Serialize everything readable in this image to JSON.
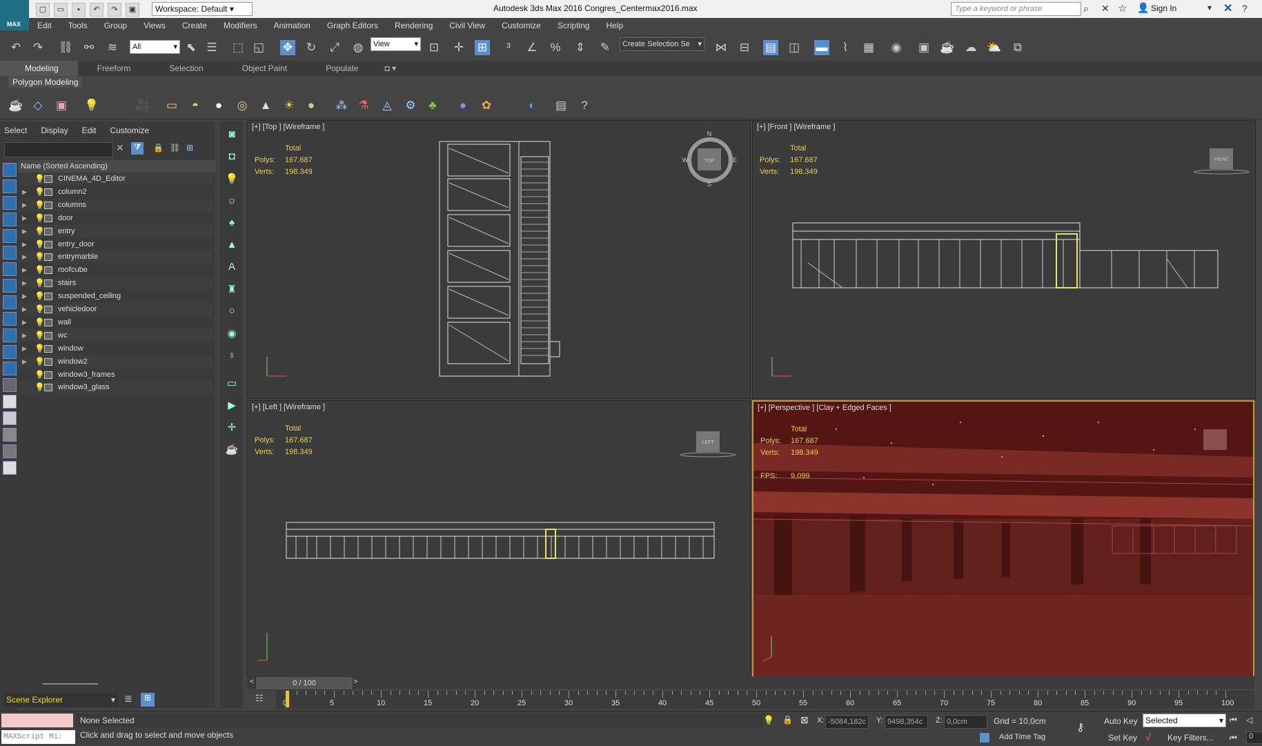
{
  "titlebar": {
    "workspace": "Workspace: Default",
    "app_title": "Autodesk 3ds Max 2016    Congres_Centermax2016.max",
    "search_placeholder": "Type a keyword or phrase",
    "sign_in": "Sign In",
    "logo_text": "MAX"
  },
  "menubar": [
    "Edit",
    "Tools",
    "Group",
    "Views",
    "Create",
    "Modifiers",
    "Animation",
    "Graph Editors",
    "Rendering",
    "Civil View",
    "Customize",
    "Scripting",
    "Help"
  ],
  "main_toolbar": {
    "selection_filter": "All",
    "ref_coord": "View",
    "named_selection": "Create Selection Se"
  },
  "ribbon": {
    "tabs": [
      "Modeling",
      "Freeform",
      "Selection",
      "Object Paint",
      "Populate"
    ],
    "active_tab": "Modeling",
    "panel_label": "Polygon Modeling"
  },
  "scene_explorer": {
    "menu": [
      "Select",
      "Display",
      "Edit",
      "Customize"
    ],
    "column_header": "Name (Sorted Ascending)",
    "items": [
      {
        "name": "CINEMA_4D_Editor",
        "expand": false
      },
      {
        "name": "column2",
        "expand": true
      },
      {
        "name": "columns",
        "expand": true
      },
      {
        "name": "door",
        "expand": true
      },
      {
        "name": "entry",
        "expand": true
      },
      {
        "name": "entry_door",
        "expand": true
      },
      {
        "name": "entrymarble",
        "expand": true
      },
      {
        "name": "roofcube",
        "expand": true
      },
      {
        "name": "stairs",
        "expand": true
      },
      {
        "name": "suspended_ceiling",
        "expand": true
      },
      {
        "name": "vehicledoor",
        "expand": true
      },
      {
        "name": "wall",
        "expand": true
      },
      {
        "name": "wc",
        "expand": true
      },
      {
        "name": "window",
        "expand": true
      },
      {
        "name": "window2",
        "expand": true
      },
      {
        "name": "window3_frames",
        "expand": false
      },
      {
        "name": "window3_glass",
        "expand": false
      }
    ],
    "footer_label": "Scene Explorer"
  },
  "viewports": {
    "top": {
      "label": "[+] [Top ] [Wireframe ]",
      "cube": "TOP"
    },
    "front": {
      "label": "[+] [Front ] [Wireframe ]",
      "cube": "FRONT"
    },
    "left": {
      "label": "[+] [Left ] [Wireframe ]",
      "cube": "LEFT"
    },
    "persp": {
      "label": "[+] [Perspective ] [Clay + Edged Faces ]",
      "fps_label": "FPS:",
      "fps": "9,099"
    },
    "stats": {
      "total": "Total",
      "polys_label": "Polys:",
      "polys": "167.687",
      "verts_label": "Verts:",
      "verts": "198.349"
    },
    "compass": {
      "n": "N",
      "s": "S",
      "e": "E",
      "w": "W"
    }
  },
  "timeline": {
    "slider": "0 / 100",
    "ticks": [
      "0",
      "5",
      "10",
      "15",
      "20",
      "25",
      "30",
      "35",
      "40",
      "45",
      "50",
      "55",
      "60",
      "65",
      "70",
      "75",
      "80",
      "85",
      "90",
      "95",
      "100"
    ]
  },
  "status": {
    "selection": "None Selected",
    "prompt": "Click and drag to select and move objects",
    "maxscript": "MAXScript Mi:",
    "x_label": "X:",
    "x": "-5084,182c",
    "y_label": "Y:",
    "y": "9498,354c",
    "z_label": "Z:",
    "z": "0,0cm",
    "grid": "Grid = 10,0cm",
    "add_time_tag": "Add Time Tag",
    "auto_key": "Auto Key",
    "set_key": "Set Key",
    "selected": "Selected",
    "key_filters": "Key Filters...",
    "frame": "0"
  },
  "colors": {
    "stats_text": "#e8d14c",
    "persp_bg": "#6b1f1b",
    "active_border": "#c49a3a"
  }
}
